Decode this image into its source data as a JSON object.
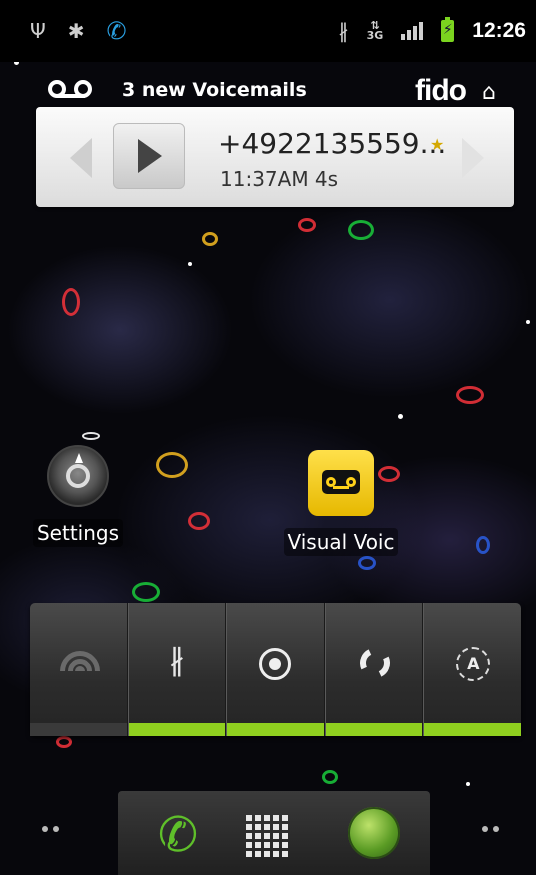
{
  "status_bar": {
    "icons": [
      "usb-icon",
      "android-debug-icon",
      "call-forward-icon",
      "bluetooth-icon",
      "3g-data-icon",
      "signal-icon",
      "battery-charging-icon"
    ],
    "network": "3G",
    "time": "12:26"
  },
  "voicemail": {
    "header_title": "3 new Voicemails",
    "carrier_logo": "fido",
    "caller": "+4922135559...",
    "time_duration": "11:37AM 4s",
    "icons": [
      "voicemail-icon",
      "home-icon",
      "prev-arrow-icon",
      "play-icon",
      "star-icon",
      "next-arrow-icon"
    ]
  },
  "desktop": {
    "apps": [
      {
        "label": "Settings",
        "icon": "settings-icon"
      },
      {
        "label": "Visual Voic",
        "icon": "visual-voicemail-icon"
      }
    ]
  },
  "power_control": {
    "buttons": [
      {
        "name": "wifi",
        "icon": "wifi-icon",
        "enabled": false
      },
      {
        "name": "bluetooth",
        "icon": "bluetooth-icon",
        "enabled": true
      },
      {
        "name": "gps",
        "icon": "gps-icon",
        "enabled": true
      },
      {
        "name": "sync",
        "icon": "sync-icon",
        "enabled": true
      },
      {
        "name": "brightness",
        "icon": "brightness-auto-icon",
        "enabled": true
      }
    ],
    "brightness_glyph": "A"
  },
  "dock": {
    "items": [
      "phone-icon",
      "app-launcher-icon",
      "browser-icon"
    ]
  },
  "colors": {
    "indicator_on": "#8fcf1f",
    "battery": "#7bd41f",
    "phone_green": "#5fbf2a"
  }
}
